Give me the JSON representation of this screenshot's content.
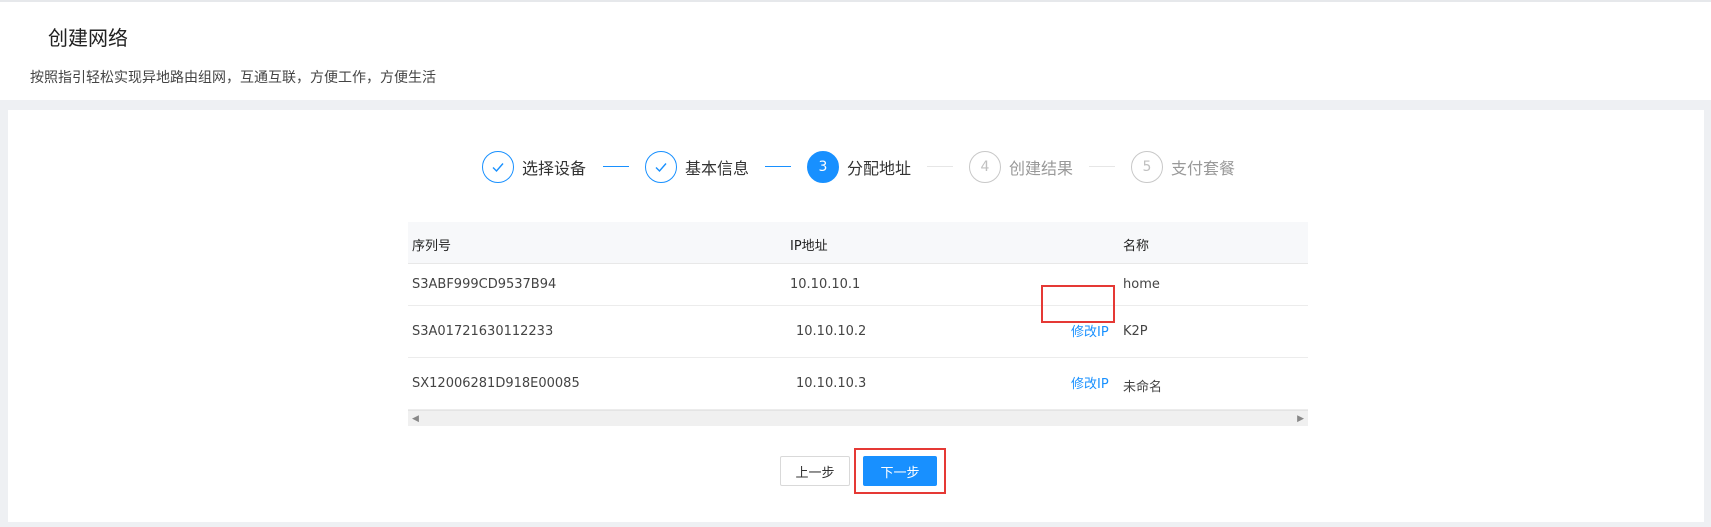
{
  "header": {
    "title": "创建网络",
    "subtitle": "按照指引轻松实现异地路由组网，互通互联，方便工作，方便生活"
  },
  "steps": [
    {
      "number": "1",
      "label": "选择设备",
      "status": "finished"
    },
    {
      "number": "2",
      "label": "基本信息",
      "status": "finished"
    },
    {
      "number": "3",
      "label": "分配地址",
      "status": "active"
    },
    {
      "number": "4",
      "label": "创建结果",
      "status": "waiting"
    },
    {
      "number": "5",
      "label": "支付套餐",
      "status": "waiting"
    }
  ],
  "table": {
    "columns": [
      "序列号",
      "IP地址",
      "名称"
    ],
    "rows": [
      {
        "serial": "S3ABF999CD9537B94",
        "ip": "10.10.10.1",
        "action": "",
        "name": "home"
      },
      {
        "serial": "S3A01721630112233",
        "ip": "10.10.10.2",
        "action": "修改IP",
        "name": "K2P"
      },
      {
        "serial": "SX12006281D918E00085",
        "ip": "10.10.10.3",
        "action": "修改IP",
        "name": "未命名"
      }
    ]
  },
  "buttons": {
    "prev": "上一步",
    "next": "下一步"
  },
  "colors": {
    "accent": "#1890ff",
    "highlight": "#e53935"
  }
}
